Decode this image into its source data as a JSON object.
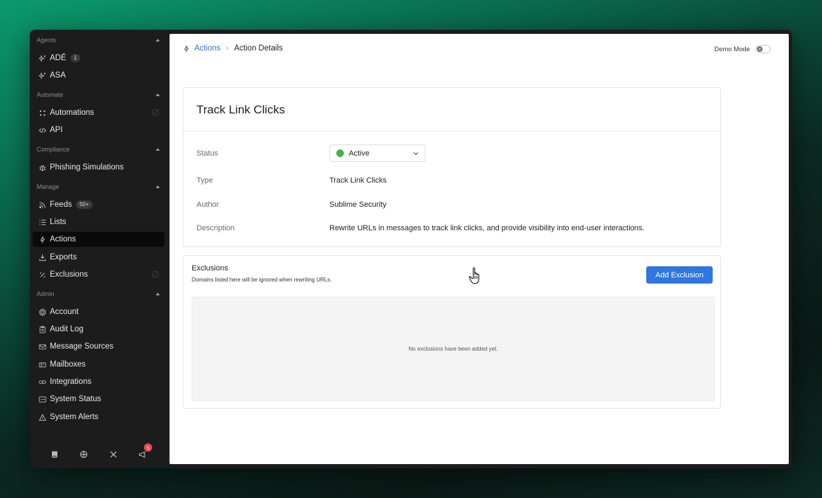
{
  "sidebar": {
    "sections": {
      "agents": "Agents",
      "automate": "Automate",
      "compliance": "Compliance",
      "manage": "Manage",
      "admin": "Admin"
    },
    "items": {
      "ade": {
        "label": "ADÉ",
        "badge": "1",
        "icon": "sparkle-agent-icon"
      },
      "asa": {
        "label": "ASA",
        "icon": "sparkle-agent-icon"
      },
      "automations": {
        "label": "Automations",
        "icon": "automations-icon"
      },
      "api": {
        "label": "API",
        "icon": "code-icon"
      },
      "phishing": {
        "label": "Phishing Simulations",
        "icon": "bug-icon"
      },
      "feeds": {
        "label": "Feeds",
        "badge": "50+",
        "icon": "rss-icon"
      },
      "lists": {
        "label": "Lists",
        "icon": "list-icon"
      },
      "actions": {
        "label": "Actions",
        "icon": "lightning-icon",
        "active": true
      },
      "exports": {
        "label": "Exports",
        "icon": "export-icon"
      },
      "exclusions": {
        "label": "Exclusions",
        "icon": "exclusions-icon"
      },
      "account": {
        "label": "Account",
        "icon": "gear-icon"
      },
      "audit": {
        "label": "Audit Log",
        "icon": "clipboard-icon"
      },
      "sources": {
        "label": "Message Sources",
        "icon": "mail-icon"
      },
      "mailboxes": {
        "label": "Mailboxes",
        "icon": "mailbox-icon"
      },
      "integrations": {
        "label": "Integrations",
        "icon": "link-icon"
      },
      "status": {
        "label": "System Status",
        "icon": "status-icon"
      },
      "alerts": {
        "label": "System Alerts",
        "icon": "warning-icon"
      }
    },
    "bottom": {
      "notifications_count": "5"
    }
  },
  "header": {
    "breadcrumb_root": "Actions",
    "breadcrumb_current": "Action Details",
    "demo_mode_label": "Demo Mode",
    "demo_mode_on": false
  },
  "details": {
    "title": "Track Link Clicks",
    "status_label": "Status",
    "status_value": "Active",
    "status_color": "#46b24a",
    "type_label": "Type",
    "type_value": "Track Link Clicks",
    "author_label": "Author",
    "author_value": "Sublime Security",
    "description_label": "Description",
    "description_value": "Rewrite URLs in messages to track link clicks, and provide visibility into end-user interactions."
  },
  "exclusions": {
    "title": "Exclusions",
    "subtitle": "Domains listed here will be ignored when rewriting URLs.",
    "add_button": "Add Exclusion",
    "empty_text": "No exclusions have been added yet."
  },
  "colors": {
    "accent": "#2f76e0",
    "link": "#2f6fdc",
    "sidebar_bg": "#1c1c1c"
  }
}
